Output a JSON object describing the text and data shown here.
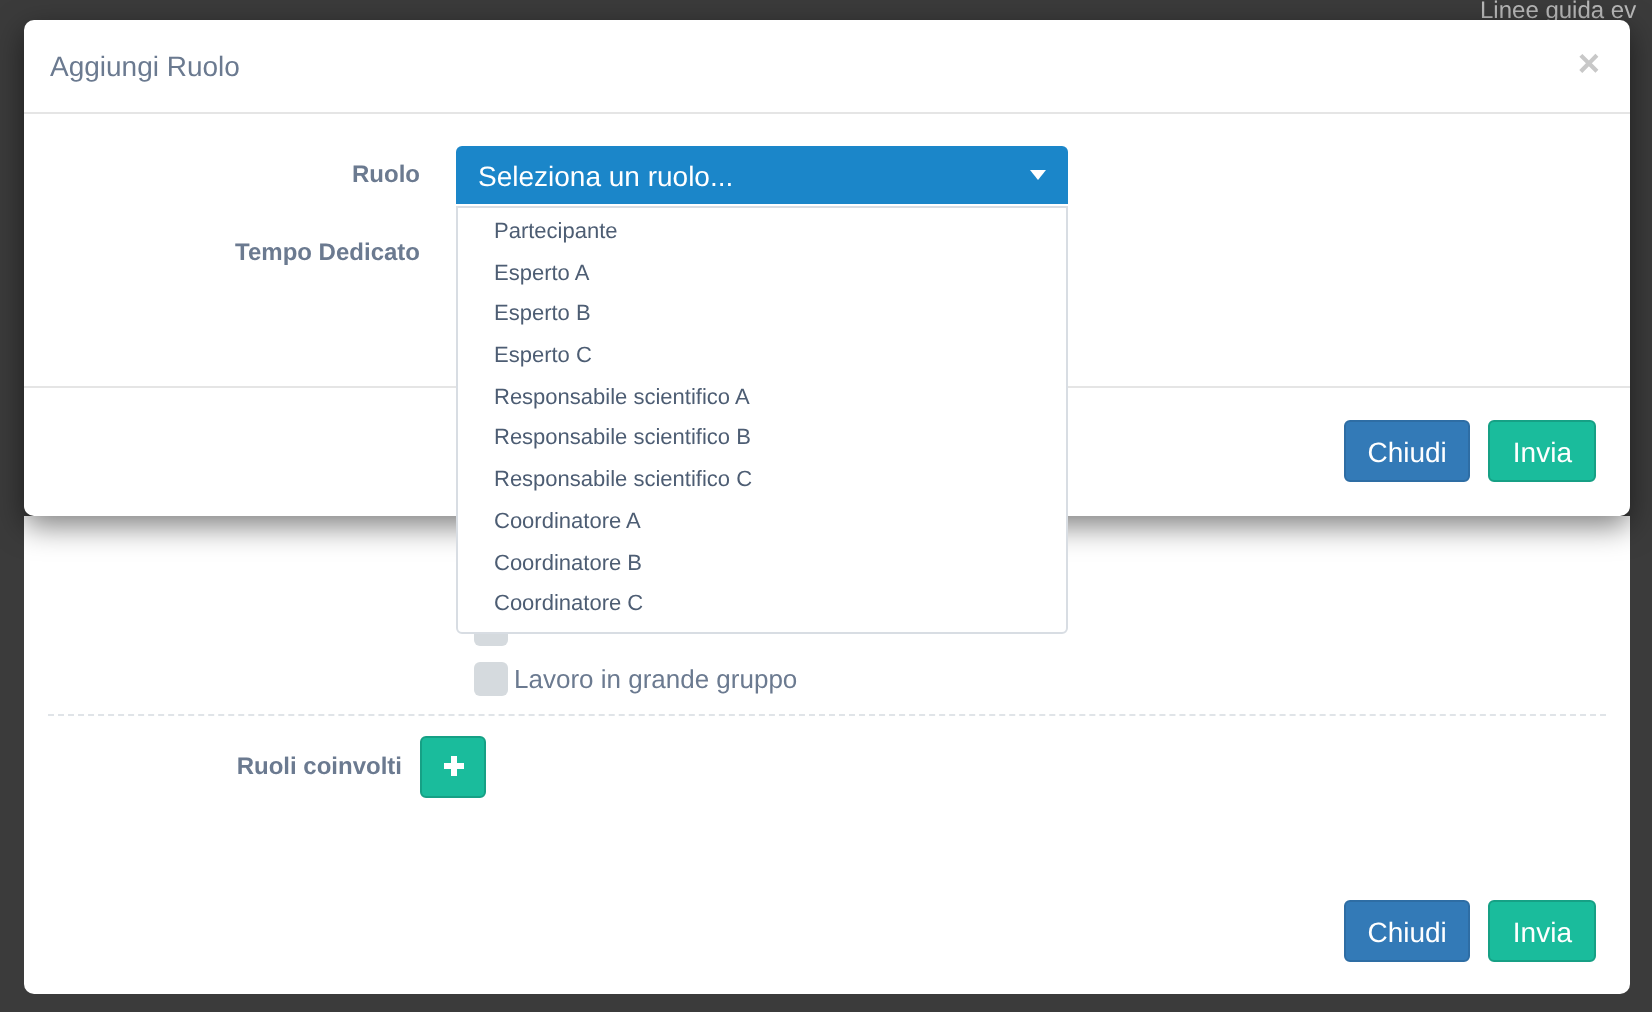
{
  "background_page": {
    "text": "Linee guida ev"
  },
  "back_dialog": {
    "options": [
      {
        "checked": false
      },
      {
        "label": "Lavoro in grande gruppo",
        "checked": false
      }
    ],
    "roles_label": "Ruoli coinvolti",
    "buttons": [
      {
        "label": "Chiudi",
        "kind": "close"
      },
      {
        "label": "Invia",
        "kind": "submit"
      }
    ]
  },
  "dialog": {
    "title": "Aggiungi Ruolo",
    "close": "×",
    "fields": [
      {
        "label": "Ruolo"
      },
      {
        "label": "Tempo Dedicato"
      }
    ],
    "select": {
      "value": "Seleziona un ruolo...",
      "expanded": true,
      "options": [
        {
          "label": "Partecipante",
          "selected": false
        },
        {
          "label": "Esperto A",
          "selected": false
        },
        {
          "label": "Esperto B",
          "selected": false
        },
        {
          "label": "Esperto C",
          "selected": false
        },
        {
          "label": "Responsabile scientifico A",
          "selected": false
        },
        {
          "label": "Responsabile scientifico B",
          "selected": false
        },
        {
          "label": "Responsabile scientifico C",
          "selected": false
        },
        {
          "label": "Coordinatore A",
          "selected": false
        },
        {
          "label": "Coordinatore B",
          "selected": false
        },
        {
          "label": "Coordinatore C",
          "selected": false
        }
      ]
    },
    "buttons": [
      {
        "label": "Chiudi",
        "kind": "close"
      },
      {
        "label": "Invia",
        "kind": "submit"
      }
    ]
  }
}
